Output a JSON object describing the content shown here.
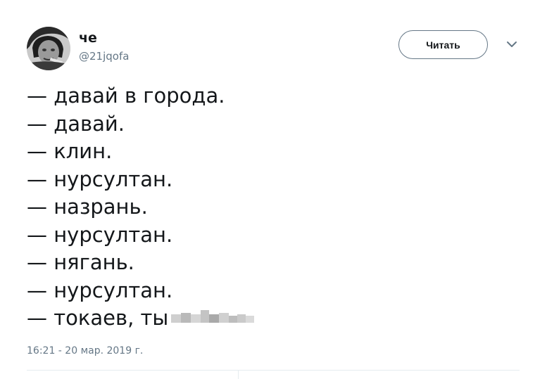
{
  "user": {
    "display_name": "че",
    "handle": "@21jqofa"
  },
  "follow_button": {
    "label": "Читать"
  },
  "tweet": {
    "lines": [
      "— давай в города.",
      "— давай.",
      "— клин.",
      "— нурсултан.",
      "— назрань.",
      "— нурсултан.",
      "— нягань.",
      "— нурсултан.",
      "— токаев, ты"
    ]
  },
  "timestamp": "16:21 - 20 мар. 2019 г.",
  "icons": {
    "menu": "chevron-down-icon"
  },
  "colors": {
    "text": "#14171a",
    "secondary": "#657786",
    "divider": "#e6ecf0"
  }
}
